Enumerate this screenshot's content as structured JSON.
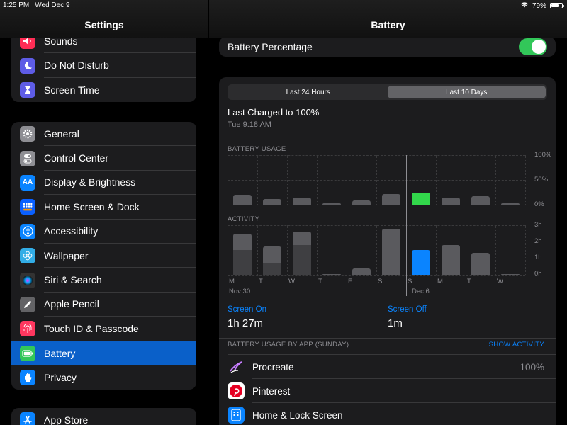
{
  "status_bar": {
    "time": "1:25 PM",
    "date": "Wed Dec 9",
    "battery_percent": "79%",
    "battery_level": 0.79
  },
  "settings": {
    "title": "Settings",
    "group1": [
      {
        "label": "Sounds",
        "icon": "speaker-icon",
        "color": "#ff2d55"
      },
      {
        "label": "Do Not Disturb",
        "icon": "moon-icon",
        "color": "#5e5ce6"
      },
      {
        "label": "Screen Time",
        "icon": "hourglass-icon",
        "color": "#5e5ce6"
      }
    ],
    "group2": [
      {
        "label": "General",
        "icon": "gear-icon",
        "color": "#8e8e93"
      },
      {
        "label": "Control Center",
        "icon": "switches-icon",
        "color": "#8e8e93"
      },
      {
        "label": "Display & Brightness",
        "icon": "text-size-icon",
        "color": "#0a84ff"
      },
      {
        "label": "Home Screen & Dock",
        "icon": "grid-icon",
        "color": "#0a60ff"
      },
      {
        "label": "Accessibility",
        "icon": "accessibility-icon",
        "color": "#0a84ff"
      },
      {
        "label": "Wallpaper",
        "icon": "flower-icon",
        "color": "#32ade6"
      },
      {
        "label": "Siri & Search",
        "icon": "siri-icon",
        "color": "#333"
      },
      {
        "label": "Apple Pencil",
        "icon": "pencil-icon",
        "color": "#636366"
      },
      {
        "label": "Touch ID & Passcode",
        "icon": "fingerprint-icon",
        "color": "#ff375f"
      },
      {
        "label": "Battery",
        "icon": "battery-icon",
        "color": "#32c759",
        "selected": true
      },
      {
        "label": "Privacy",
        "icon": "hand-icon",
        "color": "#0a84ff"
      }
    ],
    "group3": [
      {
        "label": "App Store",
        "icon": "app-store-icon",
        "color": "#0a84ff"
      }
    ]
  },
  "battery": {
    "title": "Battery",
    "percentage_label": "Battery Percentage",
    "percentage_on": true,
    "tabs": [
      "Last 24 Hours",
      "Last 10 Days"
    ],
    "active_tab": "Last 10 Days",
    "last_charged_title": "Last Charged to 100%",
    "last_charged_time": "Tue 9:18 AM",
    "usage_label": "BATTERY USAGE",
    "usage_axis": [
      "100%",
      "50%",
      "0%"
    ],
    "activity_label": "ACTIVITY",
    "activity_axis": [
      "3h",
      "2h",
      "1h",
      "0h"
    ],
    "day_labels": [
      "M",
      "T",
      "W",
      "T",
      "F",
      "S",
      "S",
      "M",
      "T",
      "W"
    ],
    "date_labels": [
      "Nov 30",
      "Dec 6"
    ],
    "screen_on_label": "Screen On",
    "screen_on_value": "1h 27m",
    "screen_off_label": "Screen Off",
    "screen_off_value": "1m",
    "by_app_label": "BATTERY USAGE BY APP (SUNDAY)",
    "show_activity": "SHOW ACTIVITY",
    "apps": [
      {
        "name": "Procreate",
        "value": "100%",
        "icon": "procreate-icon",
        "color": "#1c1c1e"
      },
      {
        "name": "Pinterest",
        "value": "—",
        "icon": "pinterest-icon",
        "color": "#ffffff"
      },
      {
        "name": "Home & Lock Screen",
        "value": "—",
        "icon": "home-screen-icon",
        "color": "#0a84ff"
      }
    ]
  },
  "chart_data": [
    {
      "type": "bar",
      "title": "BATTERY USAGE",
      "categories": [
        "M",
        "T",
        "W",
        "T",
        "F",
        "S",
        "S",
        "M",
        "T",
        "W"
      ],
      "values": [
        20,
        11,
        14,
        3,
        8,
        21,
        25,
        15,
        17,
        2
      ],
      "highlight_index": 6,
      "ylim": [
        0,
        100
      ],
      "yticks": [
        "100%",
        "50%",
        "0%"
      ]
    },
    {
      "type": "bar",
      "title": "ACTIVITY",
      "categories": [
        "M",
        "T",
        "W",
        "T",
        "F",
        "S",
        "S",
        "M",
        "T",
        "W"
      ],
      "series": [
        {
          "values": [
            2.5,
            1.7,
            2.6,
            0.05,
            0.4,
            2.8,
            1.5,
            1.8,
            1.35,
            0.05
          ]
        },
        {
          "values": [
            1.5,
            0.7,
            1.8,
            0.0,
            0.0,
            0.0,
            0.0,
            0.0,
            0.0,
            0.0
          ]
        }
      ],
      "highlight_index": 6,
      "ylim": [
        0,
        3
      ],
      "yticks": [
        "3h",
        "2h",
        "1h",
        "0h"
      ]
    }
  ]
}
